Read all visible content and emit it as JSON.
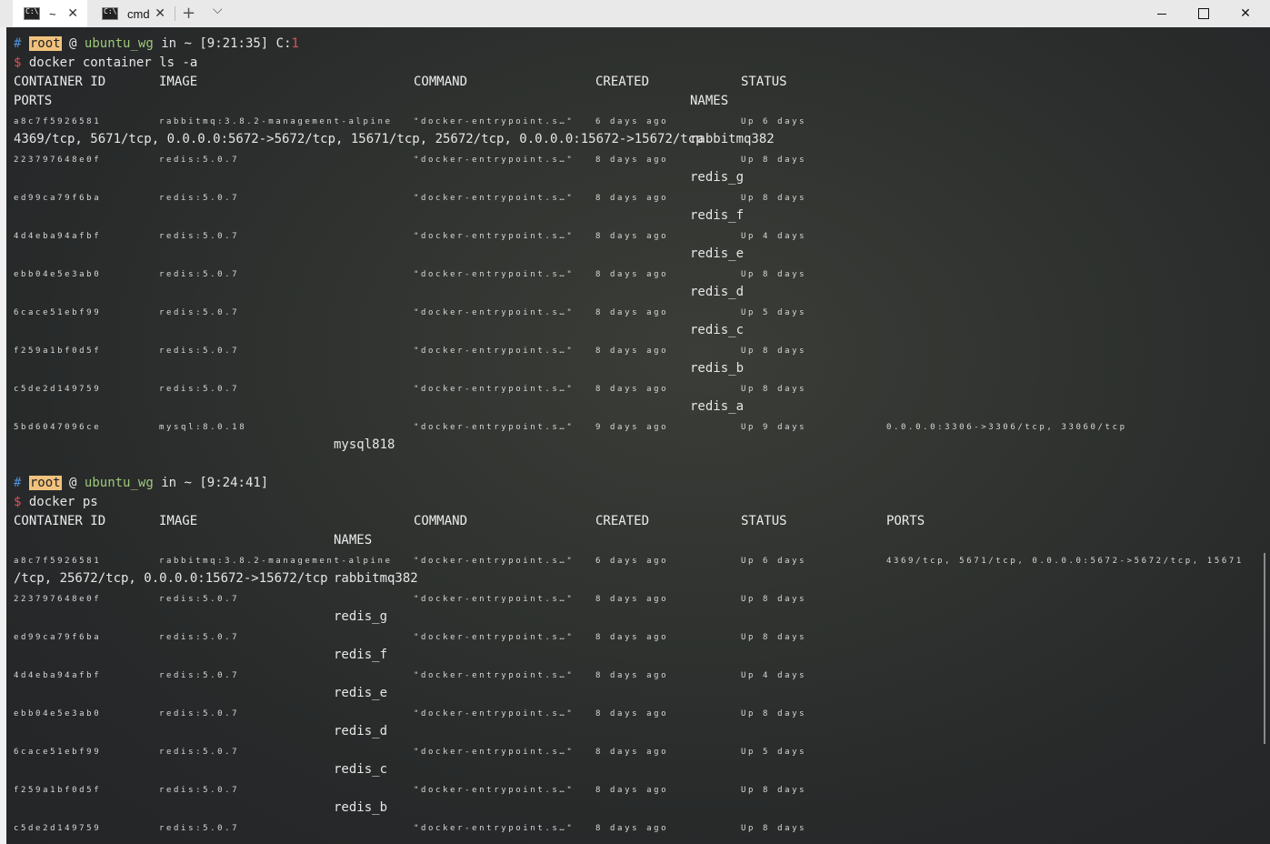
{
  "tabs": [
    {
      "label": "~",
      "active": true
    },
    {
      "label": "cmd",
      "active": false
    }
  ],
  "prompt1": {
    "hash": "#",
    "user": "root",
    "at": "@",
    "host": "ubuntu_wg",
    "in": "in",
    "dir": "~",
    "time": "[9:21:35]",
    "code_label": "C:",
    "code": "1",
    "dollar": "$",
    "command": "docker container ls -a"
  },
  "ls_headers": {
    "container_id": "CONTAINER ID",
    "image": "IMAGE",
    "command": "COMMAND",
    "created": "CREATED",
    "status": "STATUS",
    "names": "NAMES",
    "ports": "PORTS"
  },
  "ls_rows": [
    {
      "id": "a8c7f5926581",
      "image": "rabbitmq:3.8.2-management-alpine",
      "command": "\"docker-entrypoint.s…\"",
      "created": "6 days ago",
      "status": "Up 6 days",
      "ports": "4369/tcp, 5671/tcp, 0.0.0.0:5672->5672/tcp, 15671/tcp, 25672/tcp, 0.0.0.0:15672->15672/tcp",
      "name": "rabbitmq382"
    },
    {
      "id": "223797648e0f",
      "image": "redis:5.0.7",
      "command": "\"docker-entrypoint.s…\"",
      "created": "8 days ago",
      "status": "Up 8 days",
      "name": "redis_g"
    },
    {
      "id": "ed99ca79f6ba",
      "image": "redis:5.0.7",
      "command": "\"docker-entrypoint.s…\"",
      "created": "8 days ago",
      "status": "Up 8 days",
      "name": "redis_f"
    },
    {
      "id": "4d4eba94afbf",
      "image": "redis:5.0.7",
      "command": "\"docker-entrypoint.s…\"",
      "created": "8 days ago",
      "status": "Up 4 days",
      "name": "redis_e"
    },
    {
      "id": "ebb04e5e3ab0",
      "image": "redis:5.0.7",
      "command": "\"docker-entrypoint.s…\"",
      "created": "8 days ago",
      "status": "Up 8 days",
      "name": "redis_d"
    },
    {
      "id": "6cace51ebf99",
      "image": "redis:5.0.7",
      "command": "\"docker-entrypoint.s…\"",
      "created": "8 days ago",
      "status": "Up 5 days",
      "name": "redis_c"
    },
    {
      "id": "f259a1bf0d5f",
      "image": "redis:5.0.7",
      "command": "\"docker-entrypoint.s…\"",
      "created": "8 days ago",
      "status": "Up 8 days",
      "name": "redis_b"
    },
    {
      "id": "c5de2d149759",
      "image": "redis:5.0.7",
      "command": "\"docker-entrypoint.s…\"",
      "created": "8 days ago",
      "status": "Up 8 days",
      "name": "redis_a"
    },
    {
      "id": "5bd6047096ce",
      "image": "mysql:8.0.18",
      "command": "\"docker-entrypoint.s…\"",
      "created": "9 days ago",
      "status": "Up 9 days",
      "ports": "0.0.0.0:3306->3306/tcp, 33060/tcp",
      "name": "mysql818"
    }
  ],
  "prompt2": {
    "hash": "#",
    "user": "root",
    "at": "@",
    "host": "ubuntu_wg",
    "in": "in",
    "dir": "~",
    "time": "[9:24:41]",
    "dollar": "$",
    "command": "docker ps"
  },
  "ps_rows": [
    {
      "id": "a8c7f5926581",
      "image": "rabbitmq:3.8.2-management-alpine",
      "command": "\"docker-entrypoint.s…\"",
      "created": "6 days ago",
      "status": "Up 6 days",
      "ports_a": "4369/tcp, 5671/tcp, 0.0.0.0:5672->5672/tcp, 15671",
      "ports_b": "/tcp, 25672/tcp, 0.0.0.0:15672->15672/tcp",
      "name": "rabbitmq382"
    },
    {
      "id": "223797648e0f",
      "image": "redis:5.0.7",
      "command": "\"docker-entrypoint.s…\"",
      "created": "8 days ago",
      "status": "Up 8 days",
      "name": "redis_g"
    },
    {
      "id": "ed99ca79f6ba",
      "image": "redis:5.0.7",
      "command": "\"docker-entrypoint.s…\"",
      "created": "8 days ago",
      "status": "Up 8 days",
      "name": "redis_f"
    },
    {
      "id": "4d4eba94afbf",
      "image": "redis:5.0.7",
      "command": "\"docker-entrypoint.s…\"",
      "created": "8 days ago",
      "status": "Up 4 days",
      "name": "redis_e"
    },
    {
      "id": "ebb04e5e3ab0",
      "image": "redis:5.0.7",
      "command": "\"docker-entrypoint.s…\"",
      "created": "8 days ago",
      "status": "Up 8 days",
      "name": "redis_d"
    },
    {
      "id": "6cace51ebf99",
      "image": "redis:5.0.7",
      "command": "\"docker-entrypoint.s…\"",
      "created": "8 days ago",
      "status": "Up 5 days",
      "name": "redis_c"
    },
    {
      "id": "f259a1bf0d5f",
      "image": "redis:5.0.7",
      "command": "\"docker-entrypoint.s…\"",
      "created": "8 days ago",
      "status": "Up 8 days",
      "name": "redis_b"
    },
    {
      "id": "c5de2d149759",
      "image": "redis:5.0.7",
      "command": "\"docker-entrypoint.s…\"",
      "created": "8 days ago",
      "status": "Up 8 days"
    }
  ],
  "colors": {
    "prompt_hash": "#4f8fd6",
    "user_bg": "#f1c27d",
    "host": "#9ec97a",
    "code": "#e0505a"
  }
}
